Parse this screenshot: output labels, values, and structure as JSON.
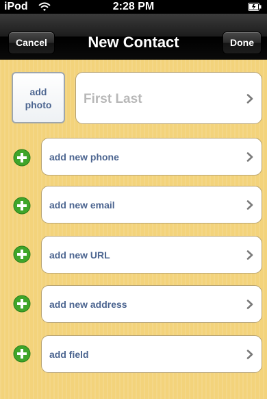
{
  "status_bar": {
    "carrier": "iPod",
    "time": "2:28 PM",
    "icons": [
      "wifi-icon",
      "battery-icon"
    ]
  },
  "nav": {
    "cancel_label": "Cancel",
    "title": "New Contact",
    "done_label": "Done"
  },
  "photo": {
    "label_line1": "add",
    "label_line2": "photo"
  },
  "name_field": {
    "placeholder": "First Last"
  },
  "rows": [
    {
      "label": "add new phone",
      "icon": "add-circle-icon"
    },
    {
      "label": "add new email",
      "icon": "add-circle-icon"
    },
    {
      "label": "add new URL",
      "icon": "add-circle-icon"
    },
    {
      "label": "add new address",
      "icon": "add-circle-icon"
    },
    {
      "label": "add field",
      "icon": "add-circle-icon"
    }
  ],
  "colors": {
    "background": "#f3d37b",
    "label_blue": "#4c6590",
    "plus_green": "#3fa52a"
  }
}
